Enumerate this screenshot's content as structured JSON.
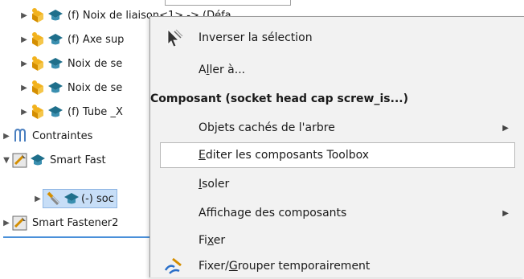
{
  "tree": {
    "items": [
      {
        "label": "(f) Noix de liaison<1> -> (Défa",
        "expand": "▶",
        "icons": [
          "part-cubes-icon",
          "mortarboard-icon"
        ]
      },
      {
        "label": "(f) Axe sup",
        "expand": "▶",
        "icons": [
          "part-cubes-icon",
          "mortarboard-icon"
        ]
      },
      {
        "label": "Noix de se",
        "expand": "▶",
        "icons": [
          "part-cubes-icon",
          "mortarboard-icon"
        ]
      },
      {
        "label": "Noix de se",
        "expand": "▶",
        "icons": [
          "part-cubes-icon",
          "mortarboard-icon"
        ]
      },
      {
        "label": "(f) Tube _X",
        "expand": "▶",
        "icons": [
          "part-cubes-icon",
          "mortarboard-icon"
        ]
      },
      {
        "label": "Contraintes",
        "expand": "▶",
        "icons": [
          "mates-icon"
        ]
      },
      {
        "label": "Smart Fast",
        "expand": "▼",
        "icons": [
          "smart-fastener-icon",
          "mortarboard-icon"
        ]
      },
      {
        "label": "(-) soc",
        "expand": "▶",
        "icons": [
          "screw-icon",
          "mortarboard-icon"
        ]
      },
      {
        "label": "Smart Fastener2",
        "expand": "▶",
        "icons": [
          "smart-fastener-icon"
        ]
      }
    ]
  },
  "menu": {
    "invert_selection": "Inverser la sélection",
    "goto_prefix": "A",
    "goto_underline": "l",
    "goto_rest": "ler à...",
    "component_header": "Composant (socket head cap screw_is...)",
    "hidden_objects": "Objets cachés de l'arbre",
    "edit_toolbox_prefix": "",
    "edit_toolbox_underline": "E",
    "edit_toolbox_rest": "diter les composants Toolbox",
    "isolate_underline": "I",
    "isolate_rest": "soler",
    "display_components": "Affichage des composants",
    "fix_prefix": "Fi",
    "fix_underline": "x",
    "fix_rest": "er",
    "fix_group_prefix": "Fixer/",
    "fix_group_underline": "G",
    "fix_group_rest": "rouper temporairement"
  },
  "colors": {
    "menu_bg": "#f2f2f2",
    "selection_highlight": "#c7def7",
    "tree_separator": "#4a90d9"
  }
}
